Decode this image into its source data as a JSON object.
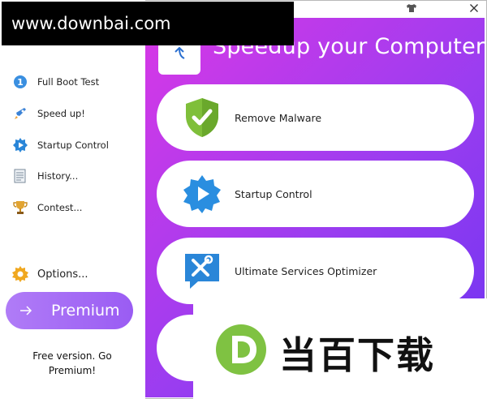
{
  "sidebar": {
    "items": [
      {
        "label": "Full Boot Test",
        "icon": "number-one-icon"
      },
      {
        "label": "Speed up!",
        "icon": "rocket-icon"
      },
      {
        "label": "Startup Control",
        "icon": "startup-gear-icon"
      },
      {
        "label": "History...",
        "icon": "history-document-icon"
      },
      {
        "label": "Contest...",
        "icon": "trophy-icon"
      }
    ],
    "options_label": "Options...",
    "premium_label": "Premium",
    "free_note": "Free version. Go Premium!"
  },
  "main": {
    "title": "Speedup your Computer",
    "cards": [
      {
        "label": "Remove Malware",
        "icon": "shield-check-icon"
      },
      {
        "label": "Startup Control",
        "icon": "startup-gear-icon"
      },
      {
        "label": "Ultimate Services Optimizer",
        "icon": "tools-icon"
      }
    ]
  },
  "watermark": {
    "top_text": "www.downbai.com",
    "bottom_text": "当百下载"
  },
  "colors": {
    "accent_start": "#d838e6",
    "accent_end": "#6e34f2",
    "premium": "#a46af5"
  }
}
